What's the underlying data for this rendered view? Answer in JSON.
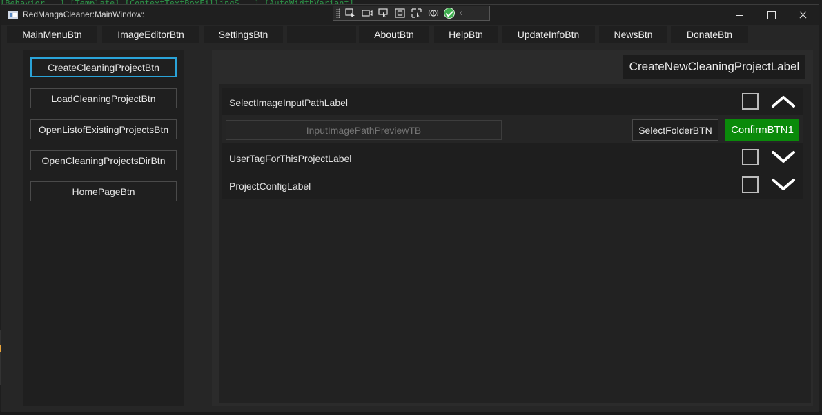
{
  "window": {
    "title": "RedMangaCleaner:MainWindow:"
  },
  "debug_toolbar": {
    "icons": [
      "grip-icon",
      "select-element-icon",
      "video-icon",
      "pointer-icon",
      "layout-bounds-icon",
      "track-focus-icon",
      "binding-failures-icon",
      "check-icon",
      "collapse-icon"
    ],
    "collapse_glyph": "‹"
  },
  "menubar": {
    "items": [
      {
        "label": "MainMenuBtn"
      },
      {
        "label": "ImageEditorBtn"
      },
      {
        "label": "SettingsBtn"
      },
      {
        "label": ""
      },
      {
        "label": "AboutBtn"
      },
      {
        "label": "HelpBtn"
      },
      {
        "label": "UpdateInfoBtn"
      },
      {
        "label": "NewsBtn"
      },
      {
        "label": "DonateBtn"
      }
    ]
  },
  "sidebar": {
    "items": [
      {
        "label": "CreateCleaningProjectBtn",
        "active": true
      },
      {
        "label": "LoadCleaningProjectBtn"
      },
      {
        "label": "OpenListofExistingProjectsBtn"
      },
      {
        "label": "OpenCleaningProjectsDirBtn"
      },
      {
        "label": "HomePageBtn"
      }
    ]
  },
  "main": {
    "title": "CreateNewCleaningProjectLabel",
    "section": {
      "select_input_label": "SelectImageInputPathLabel",
      "input_placeholder": "InputImagePathPreviewTB",
      "select_folder_label": "SelectFolderBTN",
      "confirm_label": "ConfirmBTN1",
      "user_tag_label": "UserTagForThisProjectLabel",
      "project_config_label": "ProjectConfigLabel"
    }
  },
  "colors": {
    "accent_active_border": "#2aa3d8",
    "confirm_green": "#0a8a0a",
    "background": "#262626"
  }
}
